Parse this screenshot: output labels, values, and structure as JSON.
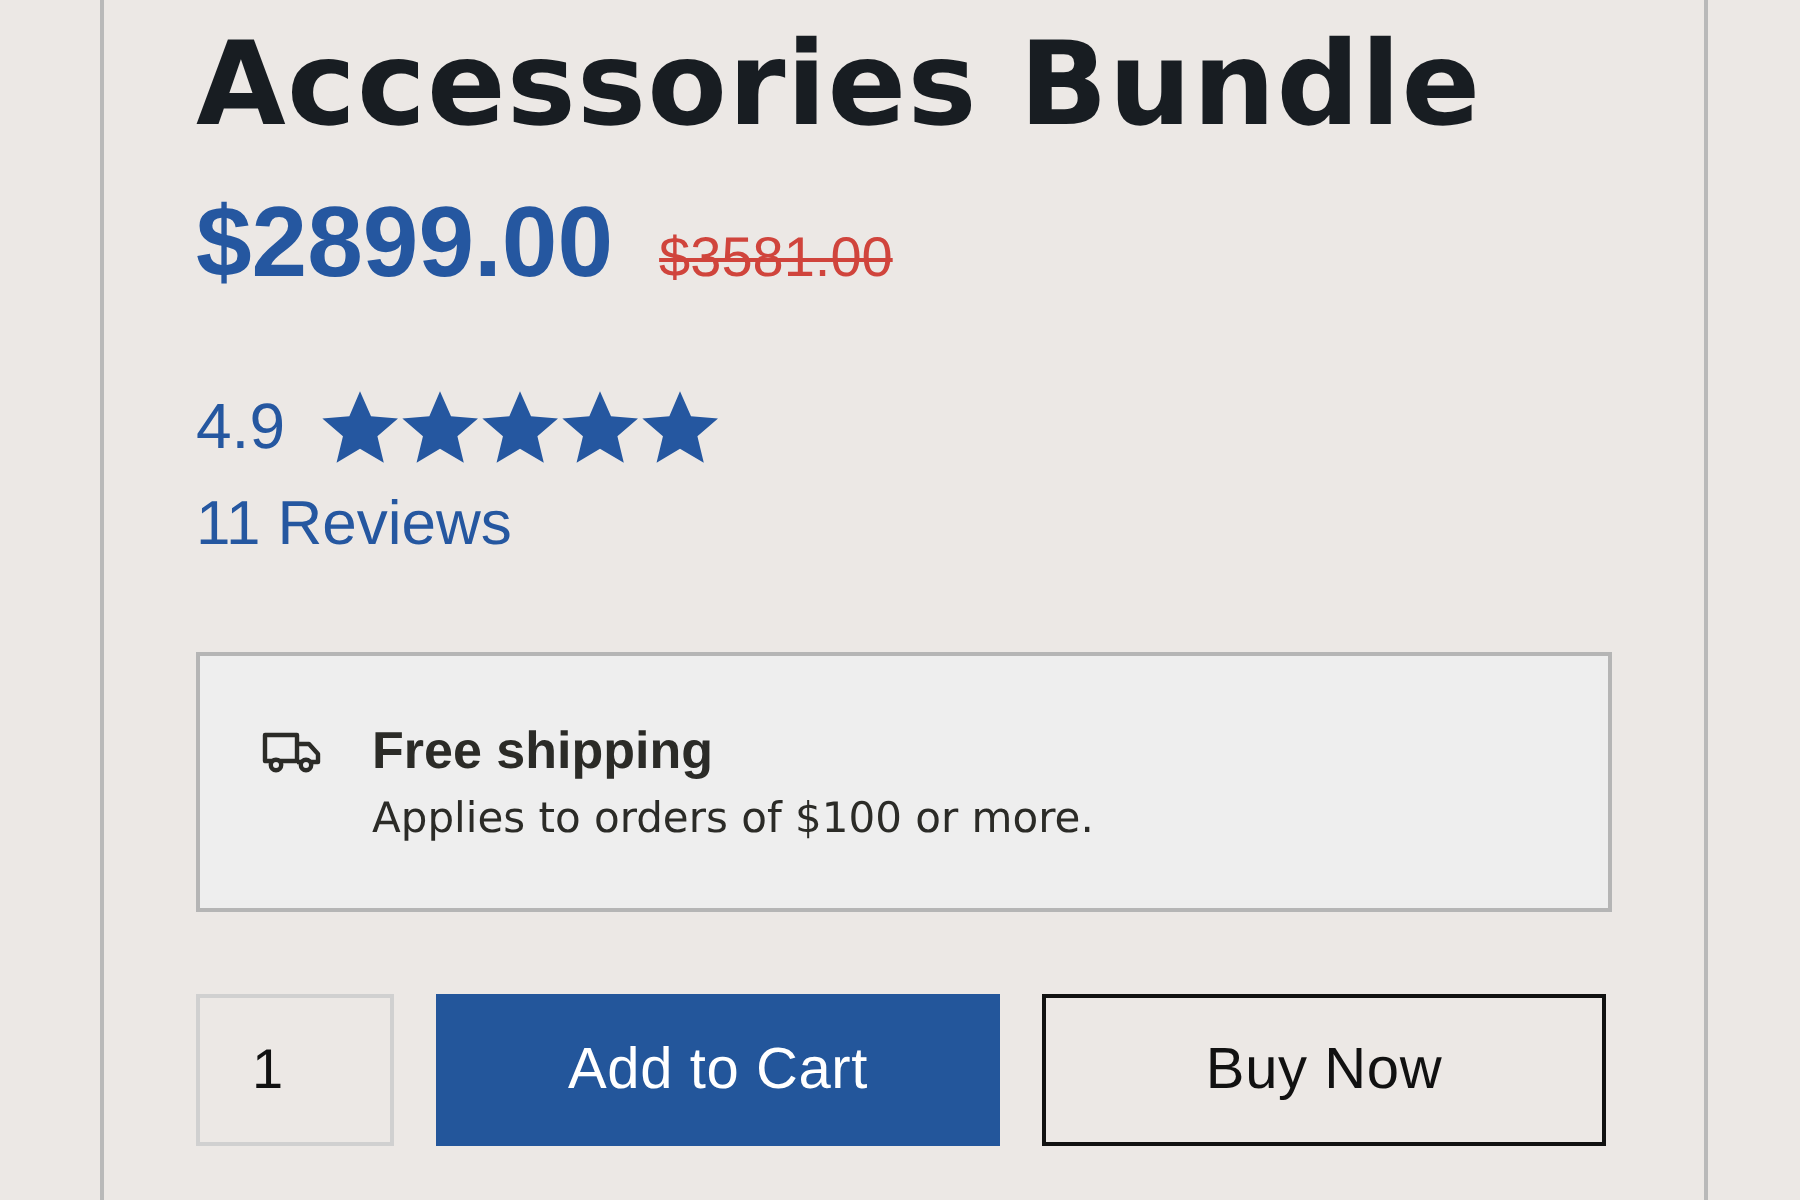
{
  "product": {
    "title": "Accessories Bundle",
    "price": "$2899.00",
    "original_price": "$3581.00",
    "rating": {
      "score": "4.9",
      "stars": 5,
      "reviews": "11 Reviews"
    }
  },
  "shipping": {
    "title": "Free shipping",
    "description": "Applies to orders of $100 or more."
  },
  "purchase": {
    "quantity": "1",
    "add_to_cart": "Add to Cart",
    "buy_now": "Buy Now"
  }
}
